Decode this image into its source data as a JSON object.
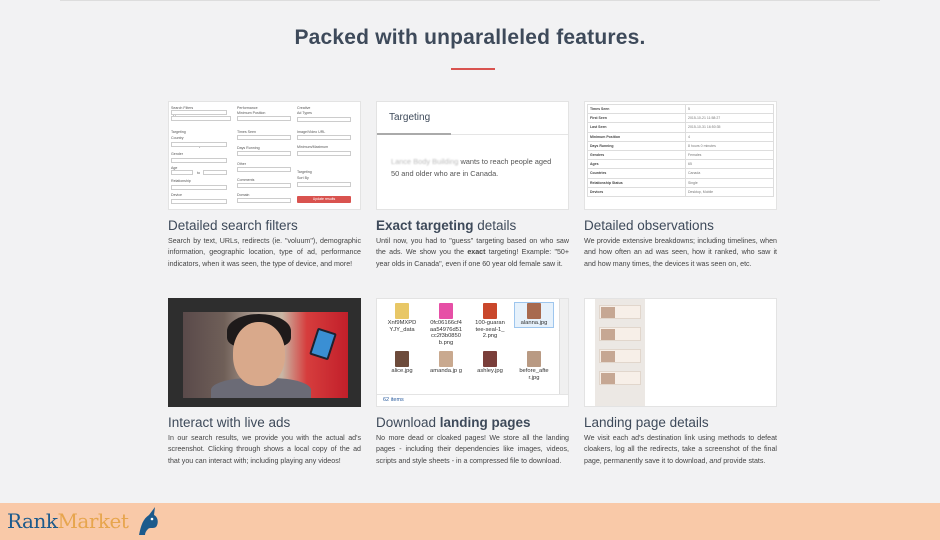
{
  "header": {
    "title_prefix": "Packed with ",
    "title_bold": "unparalleled",
    "title_suffix": " features."
  },
  "cards": [
    {
      "title_plain": "Detailed search filters",
      "description": "Search by text, URLs, redirects (ie. \"voluum\"), demographic information, geographic location, type of ad, performance indicators, when it was seen, the type of device, and more!"
    },
    {
      "title_bold": "Exact targeting",
      "title_suffix": " details",
      "description_pre": "Until now, you had to \"guess\" targeting based on who saw the ads. We show you the ",
      "description_bold": "exact",
      "description_post": " targeting! Example: \"50+ year olds in Canada\", even if one 60 year old female saw it."
    },
    {
      "title_plain": "Detailed observations",
      "description": "We provide extensive breakdowns; including timelines, when and how often an ad was seen, how it ranked, who saw it and how many times, the devices it was seen on, etc."
    },
    {
      "title_plain": "Interact with live ads",
      "description": "In our search results, we provide you with the actual ad's screenshot. Clicking through shows a local copy of the ad that you can interact with; including playing any videos!"
    },
    {
      "title_prefix": "Download ",
      "title_bold": "landing pages",
      "description": "No more dead or cloaked pages! We store all the landing pages - including their dependencies like images, videos, scripts and style sheets - in a compressed file to download."
    },
    {
      "title_plain": "Landing page details",
      "description_pre": "We visit each ad's destination link using methods to defeat cloakers, log all the redirects, take a screenshot of the final page, permanently save it to download, ",
      "description_em": "and",
      "description_post": " provide stats."
    }
  ],
  "search_filters_mock": {
    "labels": [
      "Search Filters",
      "Type in URL",
      "Targeting",
      "Country",
      "Select a country",
      "Gender",
      "All",
      "Age",
      "to",
      "Relationship",
      "All",
      "Device",
      "All",
      "Performance",
      "Minimum Position",
      "Times Seen",
      "Days Running",
      "Other",
      "Comments",
      "Domain",
      "Creative",
      "Ad Types",
      "All",
      "Image/Video URL",
      "Minimum/Maximum",
      "Targeting",
      "Sort By",
      "Date Seen"
    ],
    "button": "Update results"
  },
  "targeting_mock": {
    "heading": "Targeting",
    "blurred_name": "Lance Body Building",
    "text": " wants to reach people aged 50 and older who are in Canada."
  },
  "observations_mock": {
    "rows": [
      [
        "Times Seen",
        "5"
      ],
      [
        "First Seen",
        "2015-10-21 11:58:27"
      ],
      [
        "Last Seen",
        "2015-10-31 16:50:35"
      ],
      [
        "Minimum Position",
        "4"
      ],
      [
        "Days Running",
        "8 hours 0 minutes"
      ],
      [
        "Genders",
        "Females"
      ],
      [
        "Ages",
        "65"
      ],
      [
        "Countries",
        "Canada"
      ],
      [
        "Relationship Status",
        "Single"
      ],
      [
        "Devices",
        "Desktop, Mobile"
      ]
    ]
  },
  "file_explorer_mock": {
    "items": [
      {
        "name": "Xnf9MXPD YJY_data",
        "icon": "folder-icon",
        "color": "#e8c766"
      },
      {
        "name": "0fc06166cf4 aa54976d51 cc2f3b0850 b.png",
        "icon": "png-file-icon",
        "color": "#e64fa6"
      },
      {
        "name": "100-guaran tee-seal-1_ 2.png",
        "icon": "seal-icon",
        "color": "#c9472b"
      },
      {
        "name": "alanna.jpg",
        "icon": "photo-icon",
        "color": "#a86a4f"
      },
      {
        "name": "alice.jpg",
        "icon": "photo-icon",
        "color": "#6d4b3b"
      },
      {
        "name": "amanda.jp g",
        "icon": "photo-icon",
        "color": "#c9a98f"
      },
      {
        "name": "ashley.jpg",
        "icon": "photo-icon",
        "color": "#7a3e3a"
      },
      {
        "name": "before_afte r.jpg",
        "icon": "photo-icon",
        "color": "#b99a83"
      }
    ],
    "status": "62 items"
  },
  "footer": {
    "brand_part1": "Rank",
    "brand_part2": "Market",
    "colors": {
      "bg": "#f9c9a8",
      "brand_blue": "#1c5a8c",
      "brand_orange": "#e7a54d"
    }
  },
  "colors": {
    "accent": "#d9534f",
    "heading": "#3e4a5a"
  }
}
